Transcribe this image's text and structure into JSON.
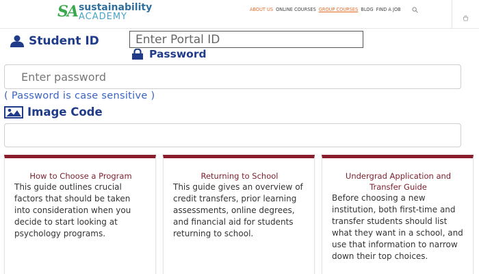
{
  "header": {
    "logo": {
      "mark": "SA",
      "line1": "sustainability",
      "line2": "ACADEMY"
    },
    "nav": [
      {
        "label": "ABOUT US",
        "state": "active"
      },
      {
        "label": "ONLINE COURSES",
        "state": "normal"
      },
      {
        "label": "GROUP COURSES",
        "state": "underline"
      },
      {
        "label": "BLOG",
        "state": "normal"
      },
      {
        "label": "FIND A JOB",
        "state": "normal"
      }
    ],
    "icons": {
      "search": "search-icon",
      "cart": "cart-icon"
    }
  },
  "form": {
    "student_id_label": "Student ID",
    "portal_placeholder": "Enter Portal ID",
    "password_label": "Password",
    "password_placeholder": "Enter password",
    "case_note": "( Password is case sensitive )",
    "image_code_label": "Image Code",
    "image_code_value": ""
  },
  "cards": [
    {
      "title": "How to Choose a Program",
      "body": "This guide outlines crucial factors that should be taken into consideration when you decide to start looking at psychology programs."
    },
    {
      "title": "Returning to School",
      "body": "This guide gives an overview of credit transfers, prior learning assessments, online degrees, and financial aid for students returning to school."
    },
    {
      "title": "Undergrad Application and Transfer Guide",
      "body": "Before choosing a new institution, both first-time and transfer students should list what they want in a school, and use that information to narrow down their top choices."
    }
  ],
  "colors": {
    "accent_nav": "#e46c2a",
    "label_blue": "#1f3b8a",
    "note_blue": "#3b63c4",
    "card_maroon": "#8a1c2b"
  }
}
